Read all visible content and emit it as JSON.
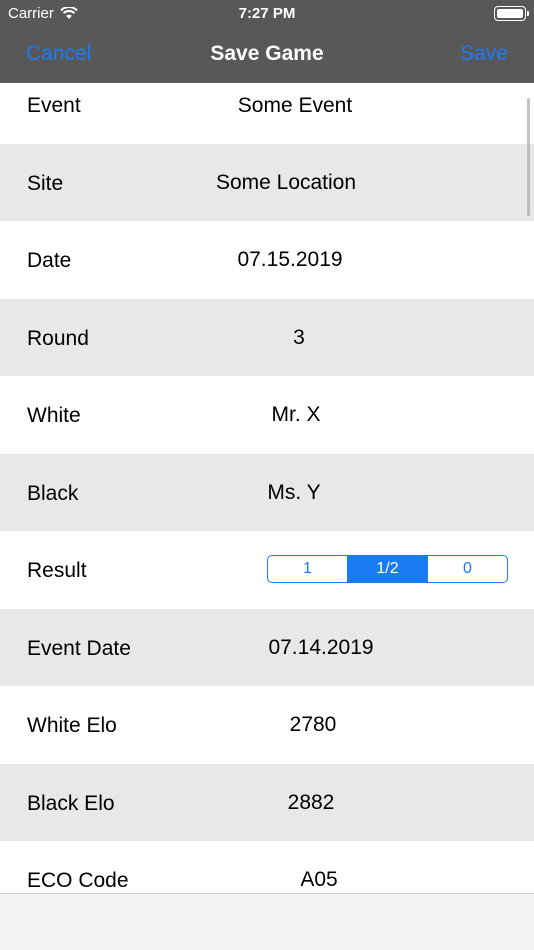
{
  "status_bar": {
    "carrier": "Carrier",
    "time": "7:27 PM",
    "wifi_icon": "wifi-icon",
    "battery_icon": "battery-icon"
  },
  "nav": {
    "cancel_label": "Cancel",
    "title": "Save Game",
    "save_label": "Save"
  },
  "rows": [
    {
      "label": "Event",
      "value": "Some Event"
    },
    {
      "label": "Site",
      "value": "Some Location"
    },
    {
      "label": "Date",
      "value": "07.15.2019"
    },
    {
      "label": "Round",
      "value": "3"
    },
    {
      "label": "White",
      "value": "Mr. X"
    },
    {
      "label": "Black",
      "value": "Ms. Y"
    },
    {
      "label": "Result",
      "options": [
        "1",
        "1/2",
        "0"
      ],
      "selected": "1/2"
    },
    {
      "label": "Event Date",
      "value": "07.14.2019"
    },
    {
      "label": "White Elo",
      "value": "2780"
    },
    {
      "label": "Black Elo",
      "value": "2882"
    },
    {
      "label": "ECO Code",
      "value": "A05"
    }
  ],
  "colors": {
    "nav_background": "#585858",
    "accent": "#1a7cf4",
    "alt_row": "#e8e8e8"
  }
}
